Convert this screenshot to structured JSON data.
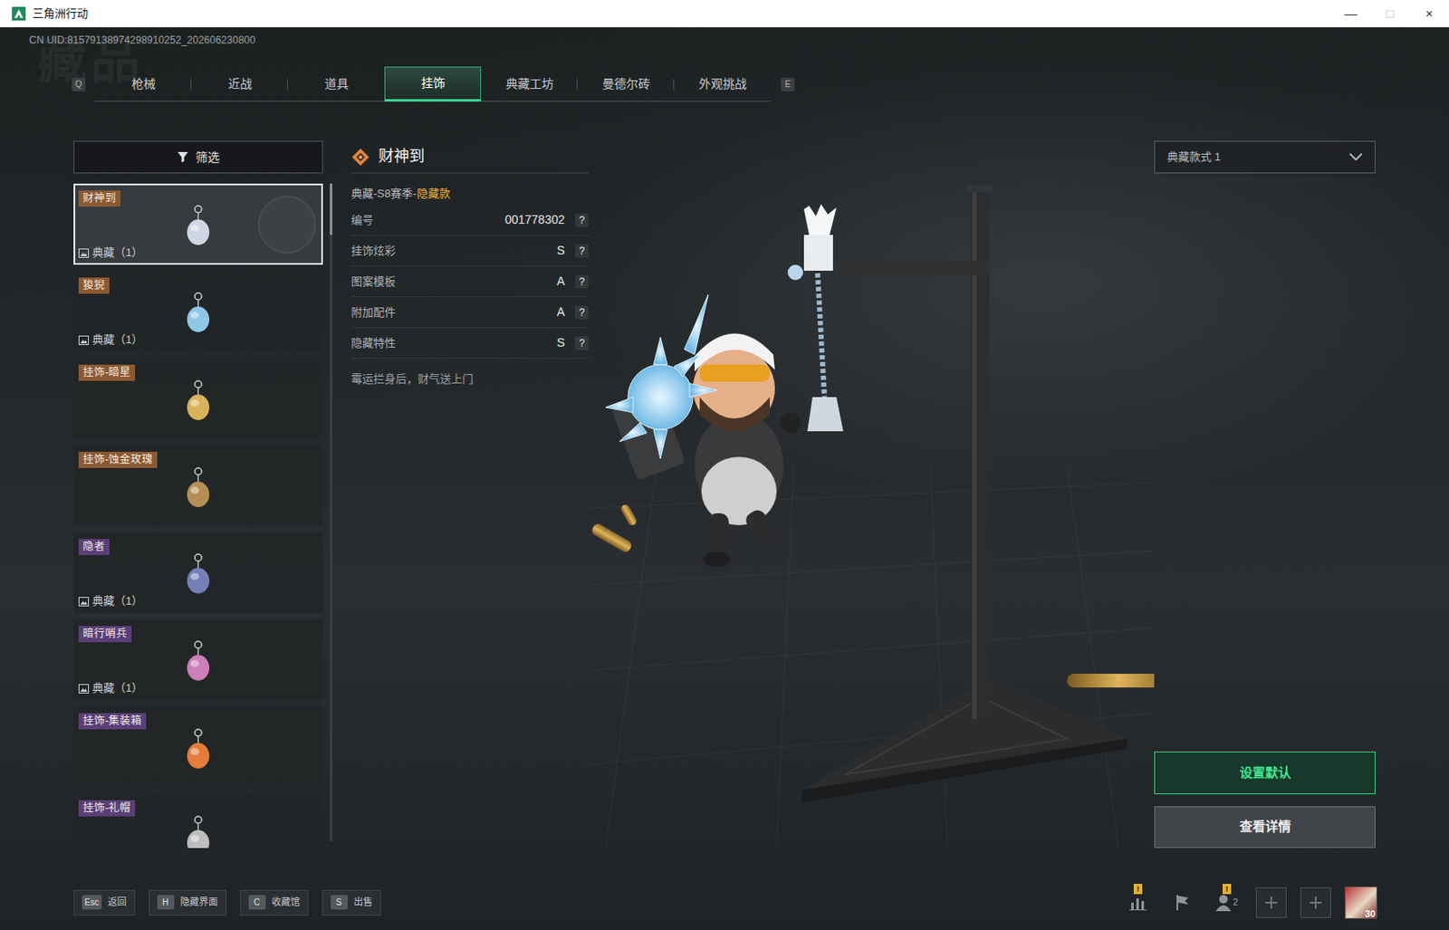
{
  "window": {
    "title": "三角洲行动",
    "controls": [
      "—",
      "□",
      "×"
    ]
  },
  "uid": "CN UID:81579138974298910252_202606230800",
  "watermark": "藏品",
  "tab_keys": {
    "prev": "Q",
    "next": "E"
  },
  "tabs": [
    {
      "label": "枪械",
      "selected": false
    },
    {
      "label": "近战",
      "selected": false
    },
    {
      "label": "道具",
      "selected": false
    },
    {
      "label": "挂饰",
      "selected": true
    },
    {
      "label": "典藏工坊",
      "selected": false
    },
    {
      "label": "曼德尔砖",
      "selected": false
    },
    {
      "label": "外观挑战",
      "selected": false
    }
  ],
  "filter": {
    "label": "筛选"
  },
  "items": [
    {
      "name": "财神到",
      "badge": "典藏（1）",
      "selected": true,
      "color": "#8b5a33"
    },
    {
      "name": "狻猊",
      "badge": "典藏（1）",
      "selected": false,
      "color": "#8b5a33"
    },
    {
      "name": "挂饰-暗星",
      "selected": false,
      "color": "#8b5a33"
    },
    {
      "name": "挂饰-蚀金玫瑰",
      "selected": false,
      "color": "#8b5a33"
    },
    {
      "name": "隐者",
      "badge": "典藏（1）",
      "selected": false,
      "color": "#5a3f78"
    },
    {
      "name": "暗行哨兵",
      "badge": "典藏（1）",
      "selected": false,
      "color": "#5a3f78"
    },
    {
      "name": "挂饰-集装箱",
      "selected": false,
      "color": "#5a3f78"
    },
    {
      "name": "挂饰-礼帽",
      "selected": false,
      "color": "#5a3f78"
    }
  ],
  "detail": {
    "title": "财神到",
    "category": "典藏-S8赛季-",
    "variant": "隐藏款",
    "rows": [
      {
        "label": "编号",
        "value": "001778302",
        "help": "?"
      },
      {
        "label": "挂饰炫彩",
        "value": "S",
        "help": "?"
      },
      {
        "label": "图案模板",
        "value": "A",
        "help": "?"
      },
      {
        "label": "附加配件",
        "value": "A",
        "help": "?"
      },
      {
        "label": "隐藏特性",
        "value": "S",
        "help": "?"
      }
    ],
    "description": "霉运拦身后，财气送上门"
  },
  "style_select": {
    "value": "典藏款式 1"
  },
  "actions": [
    {
      "label": "设置默认",
      "primary": true
    },
    {
      "label": "查看详情",
      "primary": false
    }
  ],
  "hotkeys": [
    {
      "key": "Esc",
      "label": "返回"
    },
    {
      "key": "H",
      "label": "隐藏界面"
    },
    {
      "key": "C",
      "label": "收藏馆"
    },
    {
      "key": "S",
      "label": "出售"
    }
  ],
  "tray": {
    "stats_alert": "!",
    "friends_count": "2",
    "friends_alert": "!",
    "avatar_level": "30"
  }
}
